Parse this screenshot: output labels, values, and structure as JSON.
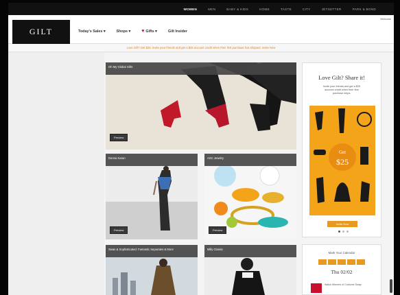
{
  "topnav": {
    "items": [
      "Women",
      "Men",
      "Baby & Kids",
      "Home",
      "Taste",
      "City",
      "Jetsetter",
      "Park & Bond"
    ],
    "active_index": 0
  },
  "header": {
    "logo": "GILT",
    "nav": {
      "todays_sales": "Today's Sales ▾",
      "shops": "Shops ▾",
      "gifts": "Gifts ▾",
      "gilt_insider": "Gilt Insider"
    },
    "welcome": "Welcome"
  },
  "promo": {
    "text": "Love Gilt? Get $25: Invite your friends and get a $25 account credit when their first purchase has shipped. Invite Now"
  },
  "tiles": [
    {
      "label": "Oh My Global Gifts",
      "button": "Preview"
    },
    {
      "label": "Donna Karan",
      "button": "Preview"
    },
    {
      "label": "ASC Jewelry",
      "button": "Preview"
    },
    {
      "label": "Swan & Sophisticated: Fantastic Separates & More",
      "button": ""
    },
    {
      "label": "Milly Classic",
      "button": ""
    }
  ],
  "share": {
    "title": "Love Gilt? Share it!",
    "description": "Invite your friends and get a $25 account credit when their first purchase ships.",
    "badge_top": "Get",
    "badge_value": "$25",
    "button": "Invite Now",
    "dots": 3
  },
  "calendar": {
    "title": "Mark Your Calendar",
    "date": "Thu 02/02",
    "event": "Watch Winners of Costume Swap"
  },
  "colors": {
    "accent_orange": "#e79a1f",
    "promo_orange": "#d9822b",
    "heart_red": "#c8102e",
    "nav_black": "#111111"
  }
}
